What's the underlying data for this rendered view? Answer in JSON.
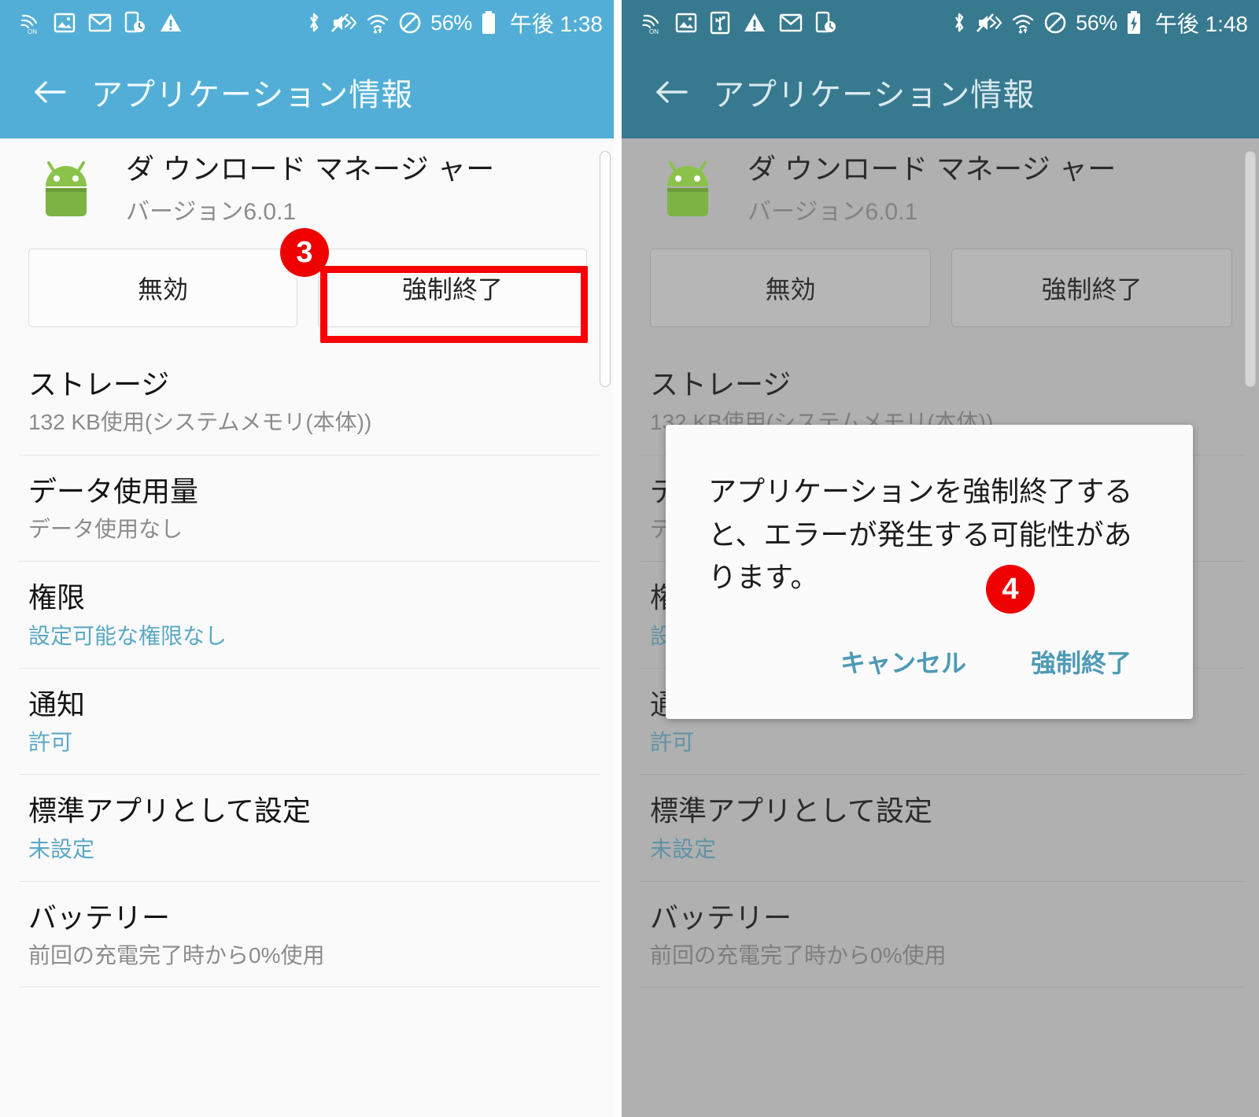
{
  "left": {
    "status_bar": {
      "icons_left": [
        "call-on-icon",
        "image-icon",
        "gmail-icon",
        "clock-device-icon",
        "warning-icon"
      ],
      "icons_right": [
        "bluetooth-icon",
        "mute-icon",
        "wifi-icon",
        "do-not-disturb-icon"
      ],
      "battery_percent": "56%",
      "battery_state": "normal",
      "clock": "午後 1:38"
    },
    "appbar": {
      "back": "back-arrow",
      "title": "アプリケーション情報"
    },
    "app": {
      "name": "ダ ウンロード マネージ ャー",
      "version": "バージョン6.0.1"
    },
    "buttons": {
      "disable": "無効",
      "force_stop": "強制終了"
    },
    "annotation": {
      "badge": "3"
    },
    "list": [
      {
        "title": "ストレージ",
        "subtitle": "132 KB使用(システムメモリ(本体))",
        "link": false
      },
      {
        "title": "データ使用量",
        "subtitle": "データ使用なし",
        "link": false
      },
      {
        "title": "権限",
        "subtitle": "設定可能な権限なし",
        "link": true
      },
      {
        "title": "通知",
        "subtitle": "許可",
        "link": true
      },
      {
        "title": "標準アプリとして設定",
        "subtitle": "未設定",
        "link": true
      },
      {
        "title": "バッテリー",
        "subtitle": "前回の充電完了時から0%使用",
        "link": false
      }
    ]
  },
  "right": {
    "status_bar": {
      "icons_left": [
        "call-on-icon",
        "image-icon",
        "usb-icon",
        "warning-icon",
        "gmail-icon",
        "clock-device-icon"
      ],
      "icons_right": [
        "bluetooth-icon",
        "mute-icon",
        "wifi-icon",
        "do-not-disturb-icon"
      ],
      "battery_percent": "56%",
      "battery_state": "charging",
      "clock": "午後 1:48"
    },
    "appbar": {
      "back": "back-arrow",
      "title": "アプリケーション情報"
    },
    "app": {
      "name": "ダ ウンロード マネージ ャー",
      "version": "バージョン6.0.1"
    },
    "buttons": {
      "disable": "無効",
      "force_stop": "強制終了"
    },
    "annotation": {
      "badge": "4"
    },
    "list": [
      {
        "title": "ストレージ",
        "subtitle": "132 KB使用(システムメモリ(本体))",
        "link": false
      },
      {
        "title": "データ使用量",
        "subtitle": "データ使用なし",
        "link": false
      },
      {
        "title": "権限",
        "subtitle": "設定可能な権限なし",
        "link": true
      },
      {
        "title": "通知",
        "subtitle": "許可",
        "link": true
      },
      {
        "title": "標準アプリとして設定",
        "subtitle": "未設定",
        "link": true
      },
      {
        "title": "バッテリー",
        "subtitle": "前回の充電完了時から0%使用",
        "link": false
      }
    ],
    "dialog": {
      "message": "アプリケーションを強制終了すると、エラーが発生する可能性があります。",
      "cancel": "キャンセル",
      "confirm": "強制終了"
    }
  },
  "colors": {
    "accent": "#52aed6",
    "accent_dim": "#37798f",
    "highlight": "#fa0000",
    "badge": "#ef0000",
    "link": "#5aa8c4",
    "dim_background": "#b0b0b0"
  }
}
